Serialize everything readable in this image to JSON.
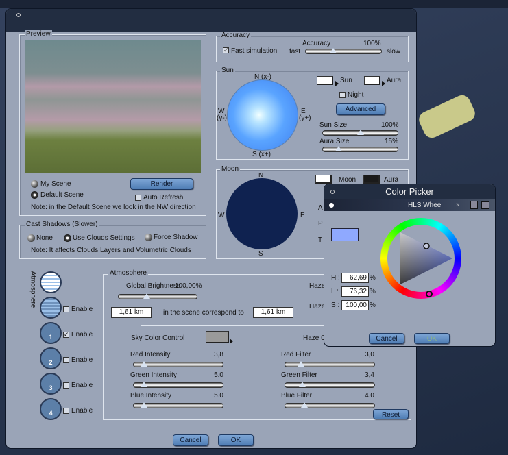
{
  "dialog": {
    "title_icon": "circle-icon"
  },
  "preview": {
    "legend": "Preview",
    "my_scene": "My Scene",
    "default_scene": "Default Scene",
    "selected": "Default Scene",
    "render": "Render",
    "auto_refresh": "Auto Refresh",
    "auto_refresh_checked": false,
    "note": "Note: in the Default Scene we look in the NW direction"
  },
  "shadows": {
    "legend": "Cast Shadows (Slower)",
    "none": "None",
    "clouds": "Use Clouds Settings",
    "force": "Force Shadow",
    "selected": "Use Clouds Settings",
    "note": "Note: It affects Clouds Layers and Volumetric Clouds"
  },
  "accuracy": {
    "legend": "Accuracy",
    "fast_sim": "Fast simulation",
    "fast_sim_checked": true,
    "label": "Accuracy",
    "value": "100%",
    "fast": "fast",
    "slow": "slow",
    "pos": 0.35
  },
  "sun": {
    "legend": "Sun",
    "n": "N (x-)",
    "s": "S (x+)",
    "w": "W",
    "wy": "(y-)",
    "e": "E",
    "ey": "(y+)",
    "sun": "Sun",
    "aura": "Aura",
    "night": "Night",
    "advanced": "Advanced",
    "size_label": "Sun Size",
    "size_value": "100%",
    "size_pos": 0.5,
    "aura_label": "Aura Size",
    "aura_value": "15%",
    "aura_pos": 0.18
  },
  "moon": {
    "legend": "Moon",
    "n": "N",
    "s": "S",
    "w": "W",
    "e": "E",
    "moon": "Moon",
    "aura": "Aura",
    "hidden1": "A",
    "hidden2": "P",
    "hidden3": "T"
  },
  "atmosphere": {
    "side_label": "Atmosphere",
    "enable": "Enable",
    "layers": [
      {
        "n": "",
        "checked": false
      },
      {
        "n": "1",
        "checked": true
      },
      {
        "n": "2",
        "checked": false
      },
      {
        "n": "3",
        "checked": false
      },
      {
        "n": "4",
        "checked": false
      }
    ],
    "legend": "Atmosphere",
    "brightness_label": "Global Brightness",
    "brightness_value": "100,00%",
    "brightness_pos": 0.35,
    "km1": "1,61 km",
    "correspond": "in the scene correspond to",
    "km2": "1,61 km",
    "haze1": "Haze",
    "haze2": "Haze",
    "sky_color": "Sky Color Control",
    "haze_color": "Haze C",
    "sliders_left": [
      {
        "label": "Red Intensity",
        "value": "3,8",
        "pos": 0.08
      },
      {
        "label": "Green Intensity",
        "value": "5.0",
        "pos": 0.08
      },
      {
        "label": "Blue Intensity",
        "value": "5.0",
        "pos": 0.08
      }
    ],
    "sliders_right": [
      {
        "label": "Red Filter",
        "value": "3,0",
        "pos": 0.15
      },
      {
        "label": "Green Filter",
        "value": "3,4",
        "pos": 0.17
      },
      {
        "label": "Blue Filter",
        "value": "4.0",
        "pos": 0.19
      }
    ],
    "reset": "Reset"
  },
  "footer": {
    "cancel": "Cancel",
    "ok": "OK"
  },
  "picker": {
    "title": "Color Picker",
    "mode": "HLS Wheel",
    "h_label": "H :",
    "h": "62,69",
    "l_label": "L :",
    "l": "76,32",
    "s_label": "S :",
    "s": "100,00",
    "pct": "%",
    "color": "#8fa9ff",
    "cancel": "Cancel",
    "ok": "OK"
  }
}
